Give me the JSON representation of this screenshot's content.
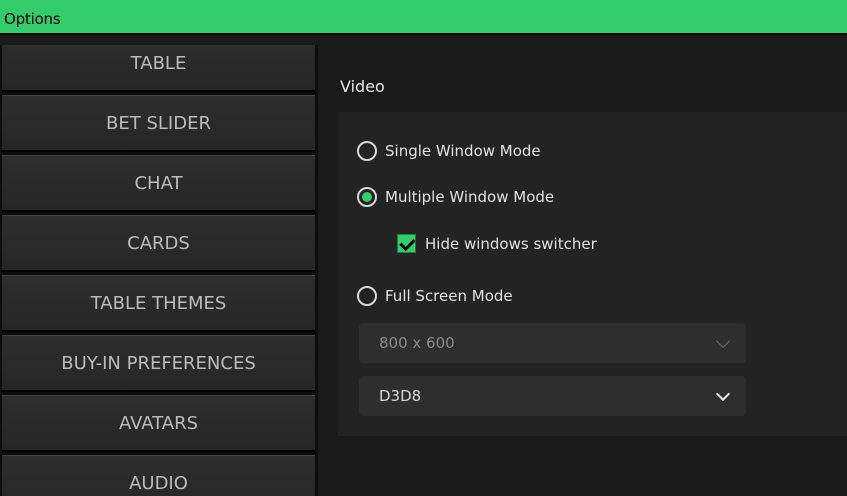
{
  "window": {
    "title": "Options"
  },
  "sidebar": {
    "items": [
      {
        "label": "TABLE"
      },
      {
        "label": "BET SLIDER"
      },
      {
        "label": "CHAT"
      },
      {
        "label": "CARDS"
      },
      {
        "label": "TABLE THEMES"
      },
      {
        "label": "BUY-IN PREFERENCES"
      },
      {
        "label": "AVATARS"
      },
      {
        "label": "AUDIO"
      }
    ]
  },
  "video": {
    "title": "Video",
    "single_window_label": "Single Window Mode",
    "multiple_window_label": "Multiple Window Mode",
    "hide_switcher_label": "Hide windows switcher",
    "hide_switcher_checked": true,
    "full_screen_label": "Full Screen Mode",
    "selected_mode": "Multiple Window Mode",
    "resolution_value": "800 x 600",
    "renderer_value": "D3D8"
  },
  "colors": {
    "accent": "#33cc6b"
  }
}
